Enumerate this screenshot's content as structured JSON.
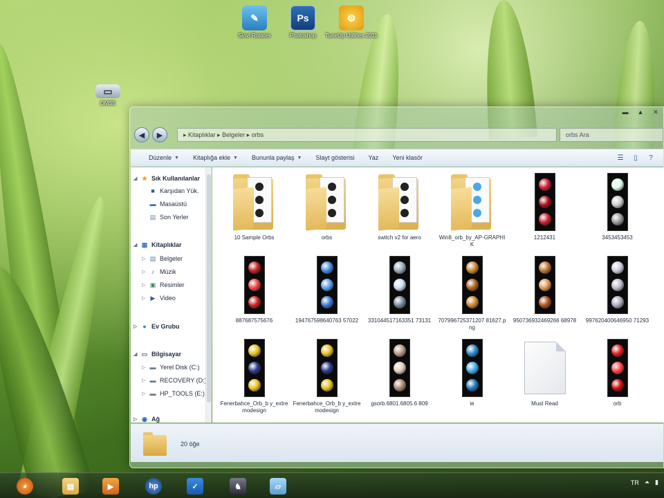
{
  "desktop": {
    "icons": [
      {
        "label": "Sinvi Rotates",
        "glyph": "✎"
      },
      {
        "label": "Photoshop",
        "glyph": "Ps"
      },
      {
        "label": "TuneUp Utilities 2011",
        "glyph": "⚙"
      },
      {
        "label": "DMS5",
        "glyph": "▭"
      }
    ]
  },
  "window": {
    "caption_buttons": [
      "▬",
      "▲",
      "✕"
    ],
    "address_text": "▸ Kitaplıklar ▸ Belgeler ▸ orbs",
    "search_placeholder": "orbs Ara",
    "toolbar": {
      "organize": "Düzenle",
      "add_to_library": "Kitaplığa ekle",
      "share_with": "Bununla paylaş",
      "slideshow": "Slayt gösterisi",
      "print": "Yaz",
      "new_folder": "Yeni klasör"
    },
    "nav": {
      "favorites": "Sık Kullanılanlar",
      "downloads": "Karşıdan Yük.",
      "desktop": "Masaüstü",
      "recent": "Son Yerler",
      "libraries": "Kitaplıklar",
      "documents": "Belgeler",
      "music": "Müzik",
      "pictures": "Resimler",
      "videos": "Video",
      "homegroup": "Ev Grubu",
      "computer": "Bilgisayar",
      "local_disk": "Yerel Disk (C:)",
      "recovery": "RECOVERY (D:)",
      "hp_tools": "HP_TOOLS (E:)",
      "network": "Ağ"
    },
    "items": [
      {
        "name": "10 Sample Orbs",
        "kind": "folder"
      },
      {
        "name": "orbs",
        "kind": "folder"
      },
      {
        "name": "switch v2 for aero",
        "kind": "folder"
      },
      {
        "name": "Win8_orb_by_AP-GRAPHIK",
        "kind": "folder"
      },
      {
        "name": "1212431",
        "kind": "strip"
      },
      {
        "name": "3453453453",
        "kind": "strip"
      },
      {
        "name": "887687575676",
        "kind": "strip"
      },
      {
        "name": "194767598640763 57022",
        "kind": "strip"
      },
      {
        "name": "331044517163351 73131",
        "kind": "strip"
      },
      {
        "name": "707996725371207 81627.png",
        "kind": "strip"
      },
      {
        "name": "950736932469266 68978",
        "kind": "strip"
      },
      {
        "name": "997620400646950 71293",
        "kind": "strip"
      },
      {
        "name": "Fenerbahce_Orb_b y_extremodesign",
        "kind": "strip"
      },
      {
        "name": "Fenerbahce_Orb_b y_extremodesign",
        "kind": "strip"
      },
      {
        "name": "gsorb.6801.6805.6 809",
        "kind": "strip"
      },
      {
        "name": "ie",
        "kind": "strip"
      },
      {
        "name": "Must Read",
        "kind": "doc"
      },
      {
        "name": "orb",
        "kind": "strip"
      }
    ],
    "details_count": "20 öğe"
  },
  "taskbar": {
    "apps": [
      "firefox",
      "explorer",
      "media",
      "hp",
      "check",
      "game",
      "notes"
    ],
    "lang": "TR"
  },
  "colors": {
    "folder": "#e9c46a",
    "accent": "#2b5b8f"
  }
}
